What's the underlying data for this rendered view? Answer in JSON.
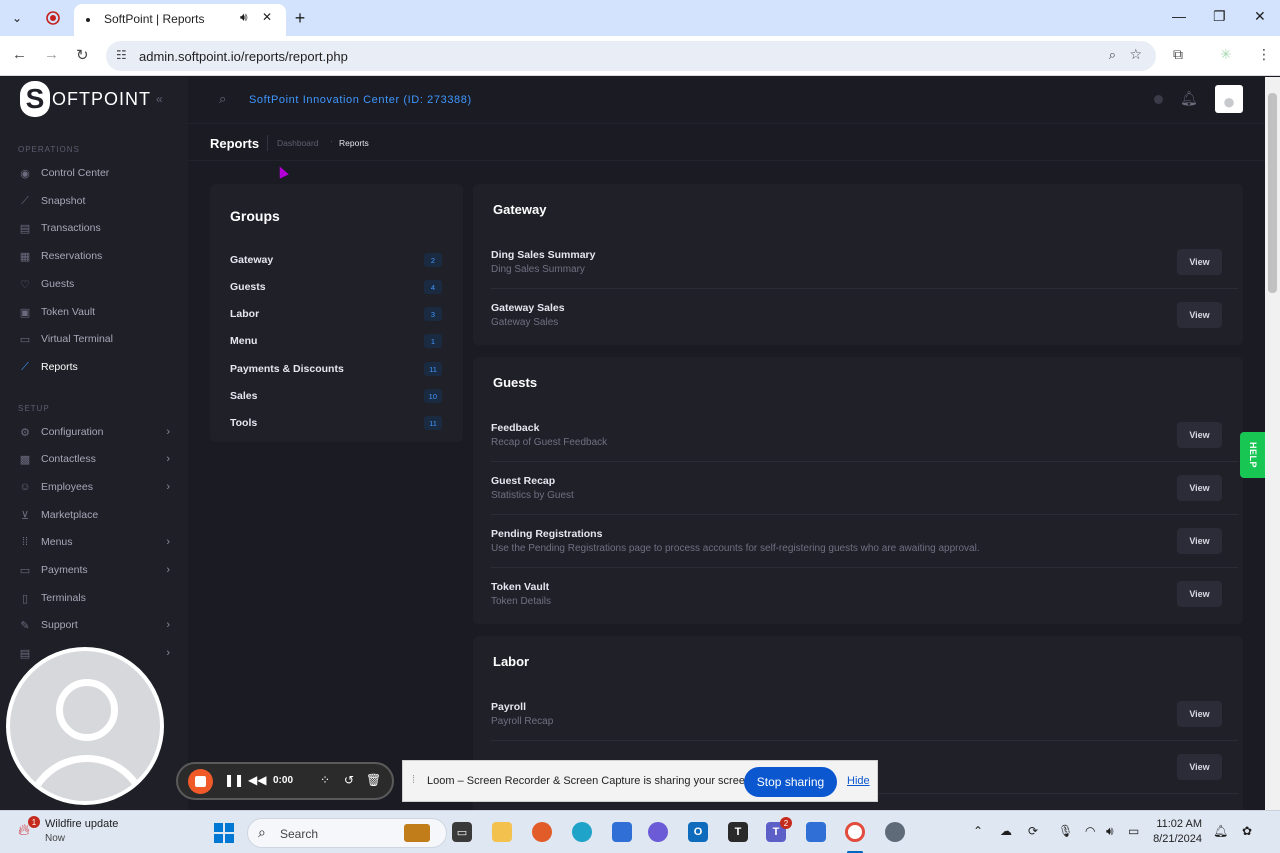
{
  "browser": {
    "tab_title": "SoftPoint | Reports",
    "new_tab_label": "+",
    "url": "admin.softpoint.io/reports/report.php"
  },
  "app": {
    "logo_text": "OFTPOINT",
    "logo_letter": "S",
    "org_name": "SoftPoint Innovation Center (ID: 273388)",
    "page_title": "Reports",
    "breadcrumb": [
      "Dashboard",
      "Reports"
    ],
    "help_label": "HELP"
  },
  "sidebar": {
    "section_operations": "OPERATIONS",
    "section_setup": "SETUP",
    "operations": [
      {
        "label": "Control Center",
        "icon": "eye-icon"
      },
      {
        "label": "Snapshot",
        "icon": "chart-icon"
      },
      {
        "label": "Transactions",
        "icon": "list-icon"
      },
      {
        "label": "Reservations",
        "icon": "calendar-icon"
      },
      {
        "label": "Guests",
        "icon": "heart-icon"
      },
      {
        "label": "Token Vault",
        "icon": "vault-icon"
      },
      {
        "label": "Virtual Terminal",
        "icon": "terminal-icon"
      },
      {
        "label": "Reports",
        "icon": "report-icon",
        "active": true
      }
    ],
    "setup": [
      {
        "label": "Configuration",
        "icon": "config-icon",
        "has_children": true
      },
      {
        "label": "Contactless",
        "icon": "qr-icon",
        "has_children": true
      },
      {
        "label": "Employees",
        "icon": "people-icon",
        "has_children": true
      },
      {
        "label": "Marketplace",
        "icon": "cart-icon"
      },
      {
        "label": "Menus",
        "icon": "grid-icon",
        "has_children": true
      },
      {
        "label": "Payments",
        "icon": "card-icon",
        "has_children": true
      },
      {
        "label": "Terminals",
        "icon": "device-icon"
      },
      {
        "label": "Support",
        "icon": "support-icon",
        "has_children": true
      }
    ]
  },
  "groups": {
    "title": "Groups",
    "items": [
      {
        "label": "Gateway",
        "count": "2"
      },
      {
        "label": "Guests",
        "count": "4"
      },
      {
        "label": "Labor",
        "count": "3"
      },
      {
        "label": "Menu",
        "count": "1"
      },
      {
        "label": "Payments & Discounts",
        "count": "11"
      },
      {
        "label": "Sales",
        "count": "10"
      },
      {
        "label": "Tools",
        "count": "11"
      }
    ]
  },
  "sections": {
    "gateway": {
      "title": "Gateway",
      "reports": [
        {
          "name": "Ding Sales Summary",
          "desc": "Ding Sales Summary",
          "button": "View"
        },
        {
          "name": "Gateway Sales",
          "desc": "Gateway Sales",
          "button": "View"
        }
      ]
    },
    "guests": {
      "title": "Guests",
      "reports": [
        {
          "name": "Feedback",
          "desc": "Recap of Guest Feedback",
          "button": "View"
        },
        {
          "name": "Guest Recap",
          "desc": "Statistics by Guest",
          "button": "View"
        },
        {
          "name": "Pending Registrations",
          "desc": "Use the Pending Registrations page to process accounts for self-registering guests who are awaiting approval.",
          "button": "View"
        },
        {
          "name": "Token Vault",
          "desc": "Token Details",
          "button": "View"
        }
      ]
    },
    "labor": {
      "title": "Labor",
      "reports": [
        {
          "name": "Payroll",
          "desc": "Payroll Recap",
          "button": "View"
        },
        {
          "name": "",
          "desc": "",
          "button": "View"
        }
      ]
    }
  },
  "loom": {
    "timer": "0:00",
    "share_message": "Loom – Screen Recorder & Screen Capture is sharing your screen.",
    "stop_label": "Stop sharing",
    "hide_label": "Hide"
  },
  "taskbar": {
    "weather_title": "Wildfire update",
    "weather_sub": "Now",
    "weather_badge": "1",
    "search_placeholder": "Search",
    "teams_badge": "2",
    "time": "11:02 AM",
    "date": "8/21/2024"
  },
  "colors": {
    "accent": "#3e97ff",
    "help": "#17c653",
    "app_bg": "#1b1b23",
    "card_bg": "#202029",
    "loom_stop": "#f05a28"
  }
}
